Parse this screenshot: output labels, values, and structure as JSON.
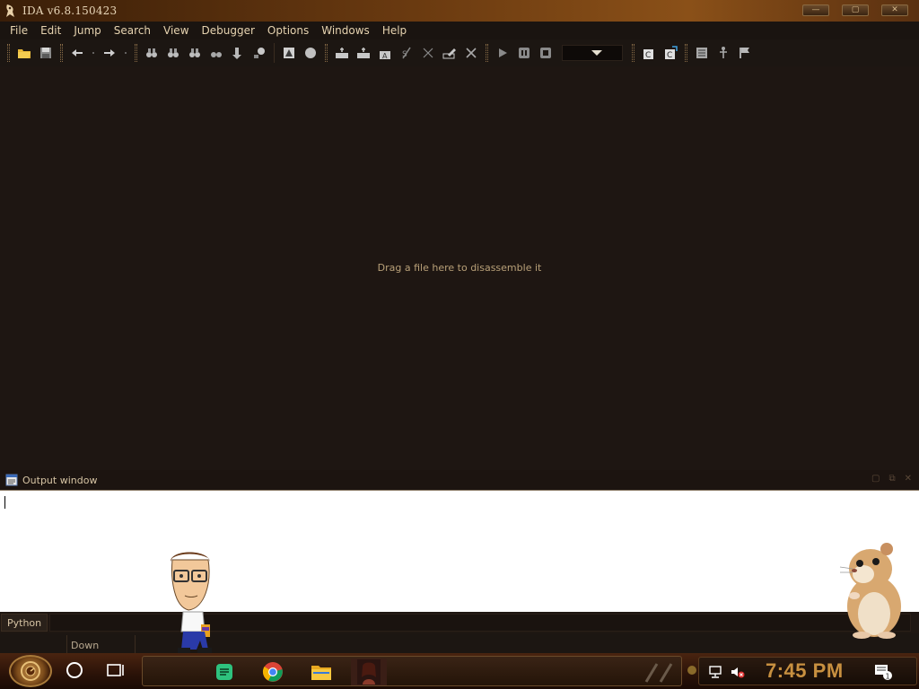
{
  "window": {
    "title": "IDA v6.8.150423"
  },
  "menu": {
    "items": [
      "File",
      "Edit",
      "Jump",
      "Search",
      "View",
      "Debugger",
      "Options",
      "Windows",
      "Help"
    ]
  },
  "main": {
    "empty_message": "Drag a file here to disassemble it"
  },
  "output": {
    "title": "Output window",
    "content": ""
  },
  "python_bar": {
    "tab_label": "Python"
  },
  "status": {
    "state": "Down"
  },
  "taskbar": {
    "clock": "7:45 PM"
  },
  "colors": {
    "accent": "#c89040",
    "title_text": "#e8d6b8",
    "menu_text": "#e6d3b0",
    "background": "#1e1612"
  }
}
